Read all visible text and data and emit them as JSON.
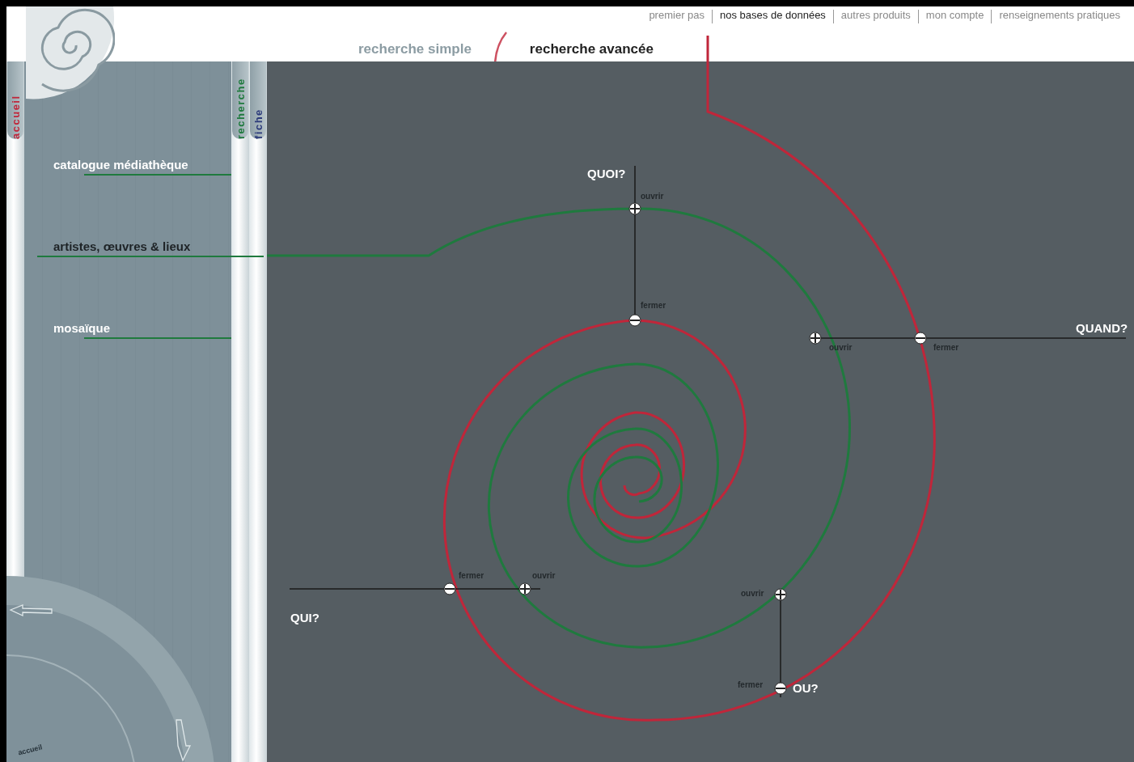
{
  "top_nav": [
    {
      "label": "premier pas",
      "selected": false
    },
    {
      "label": "nos bases de données",
      "selected": true
    },
    {
      "label": "autres produits",
      "selected": false
    },
    {
      "label": "mon compte",
      "selected": false
    },
    {
      "label": "renseignements pratiques",
      "selected": false
    }
  ],
  "search_tabs": [
    {
      "label": "recherche simple",
      "selected": false
    },
    {
      "label": "recherche avancée",
      "selected": true
    }
  ],
  "side_tabs": [
    {
      "label": "accueil",
      "color": "#c0263a"
    },
    {
      "label": "recherche",
      "color": "#1f7a3e"
    },
    {
      "label": "fiche",
      "color": "#2b3a7a"
    }
  ],
  "sidebar": {
    "items": [
      {
        "label": "catalogue médiathèque",
        "selected": false
      },
      {
        "label": "artistes, œuvres & lieux",
        "selected": true
      },
      {
        "label": "mosaïque",
        "selected": false
      }
    ],
    "wheel_label": "accueil"
  },
  "diagram": {
    "axes": [
      {
        "label": "QUOI?",
        "open": "ouvrir",
        "close": "fermer"
      },
      {
        "label": "QUAND?",
        "open": "ouvrir",
        "close": "fermer"
      },
      {
        "label": "QUI?",
        "open": "ouvrir",
        "close": "fermer"
      },
      {
        "label": "OU?",
        "open": "ouvrir",
        "close": "fermer"
      }
    ]
  }
}
